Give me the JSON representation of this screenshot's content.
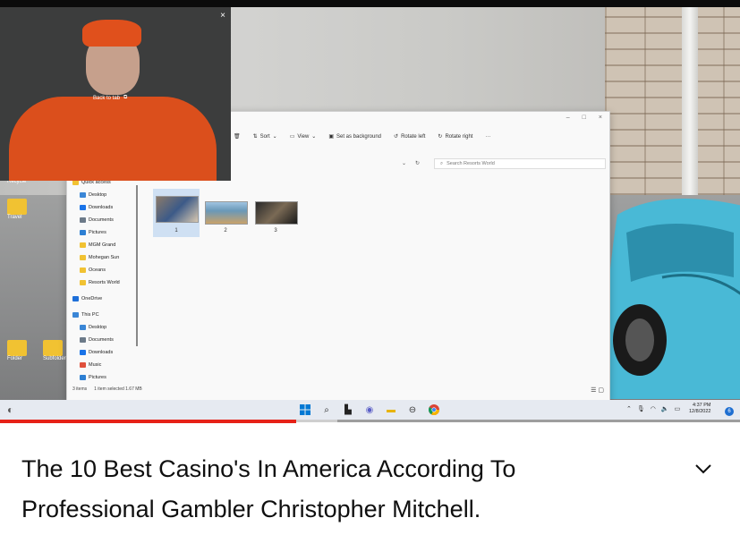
{
  "pip": {
    "close_glyph": "×",
    "back_label": "Back to tab"
  },
  "desktop": {
    "top_left_label": "Recycle",
    "icon2_label": "Travel",
    "bottom_icons": [
      {
        "label": "Folder"
      },
      {
        "label": "Subfolder"
      }
    ]
  },
  "explorer": {
    "window_controls": [
      "–",
      "□",
      "×"
    ],
    "toolbar": [
      {
        "icon": "trash-icon",
        "label": ""
      },
      {
        "icon": "sort-icon",
        "label": "Sort"
      },
      {
        "icon": "view-icon",
        "label": "View"
      },
      {
        "icon": "background-icon",
        "label": "Set as background"
      },
      {
        "icon": "rotate-left-icon",
        "label": "Rotate left"
      },
      {
        "icon": "rotate-right-icon",
        "label": "Rotate right"
      },
      {
        "icon": "more-icon",
        "label": "···"
      }
    ],
    "search_placeholder": "Search Resorts World",
    "sidebar": [
      {
        "label": "Quick access",
        "color": "#f1c232"
      },
      {
        "label": "Desktop",
        "color": "#3a86d6"
      },
      {
        "label": "Downloads",
        "color": "#1a73e8"
      },
      {
        "label": "Documents",
        "color": "#6c7a89"
      },
      {
        "label": "Pictures",
        "color": "#2d7fd3"
      },
      {
        "label": "MGM Grand",
        "color": "#f1c232"
      },
      {
        "label": "Mohegan Sun",
        "color": "#f1c232"
      },
      {
        "label": "Oceans",
        "color": "#f1c232"
      },
      {
        "label": "Resorts World",
        "color": "#f1c232"
      },
      {
        "label": "OneDrive",
        "color": "#1e6fd9"
      },
      {
        "label": "This PC",
        "color": "#3a86d6"
      },
      {
        "label": "Desktop",
        "color": "#3a86d6"
      },
      {
        "label": "Documents",
        "color": "#6c7a89"
      },
      {
        "label": "Downloads",
        "color": "#1a73e8"
      },
      {
        "label": "Music",
        "color": "#e0503c"
      },
      {
        "label": "Pictures",
        "color": "#2d7fd3"
      }
    ],
    "thumbnails": [
      {
        "label": "1"
      },
      {
        "label": "2"
      },
      {
        "label": "3"
      }
    ],
    "status": {
      "items": "3 items",
      "selected": "1 item selected  1.67 MB"
    }
  },
  "taskbar": {
    "clock_time": "4:37 PM",
    "clock_date": "12/8/2022",
    "notification_count": "6"
  },
  "player": {
    "progress_fraction": 0.4,
    "buffered_fraction": 0.456,
    "progress_color": "#e62117"
  },
  "video": {
    "title": "The 10 Best Casino's In America According To Professional Gambler Christopher Mitchell."
  }
}
